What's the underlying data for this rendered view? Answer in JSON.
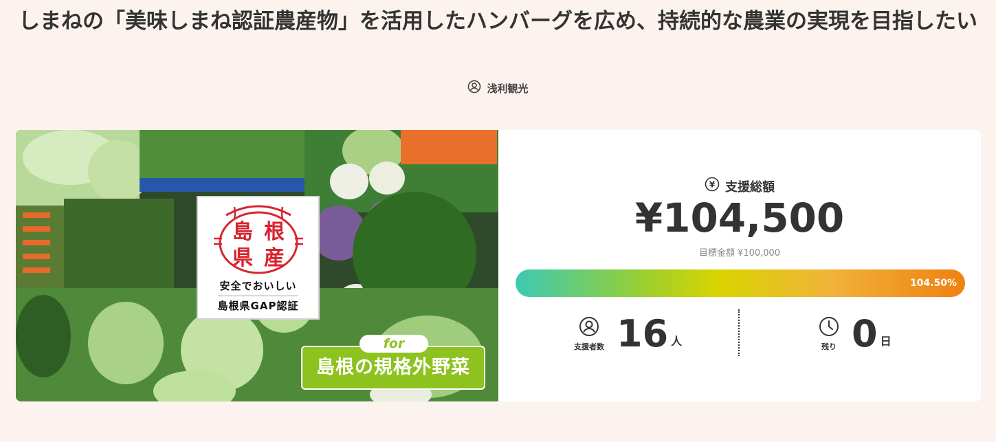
{
  "page": {
    "title": "しまねの「美味しまね認証農産物」を活用したハンバーグを広め、持続的な農業の実現を目指したい",
    "owner_name": "浅利観光",
    "owner_icon": "user-icon"
  },
  "hero": {
    "cert_seal_chars": [
      "島",
      "根",
      "県",
      "産"
    ],
    "cert_line1": "安全でおいしい",
    "cert_line2": "島根県GAP認証",
    "promo_for": "for",
    "promo_text": "島根の規格外野菜"
  },
  "stats": {
    "total_icon": "yen-icon",
    "total_label": "支援総額",
    "total_amount": "¥104,500",
    "goal_text": "目標金額 ¥100,000",
    "progress_text": "104.50%",
    "progress_fraction": 1.045,
    "supporters_icon": "user-icon",
    "supporters_label": "支援者数",
    "supporters_count": "16",
    "supporters_unit": "人",
    "remaining_icon": "clock-icon",
    "remaining_label": "残り",
    "remaining_count": "0",
    "remaining_unit": "日"
  },
  "colors": {
    "background": "#fcf3ee",
    "promo_green": "#8dc21f",
    "seal_red": "#d9232e",
    "progress_start": "#3cc9b4",
    "progress_end": "#f08010"
  }
}
